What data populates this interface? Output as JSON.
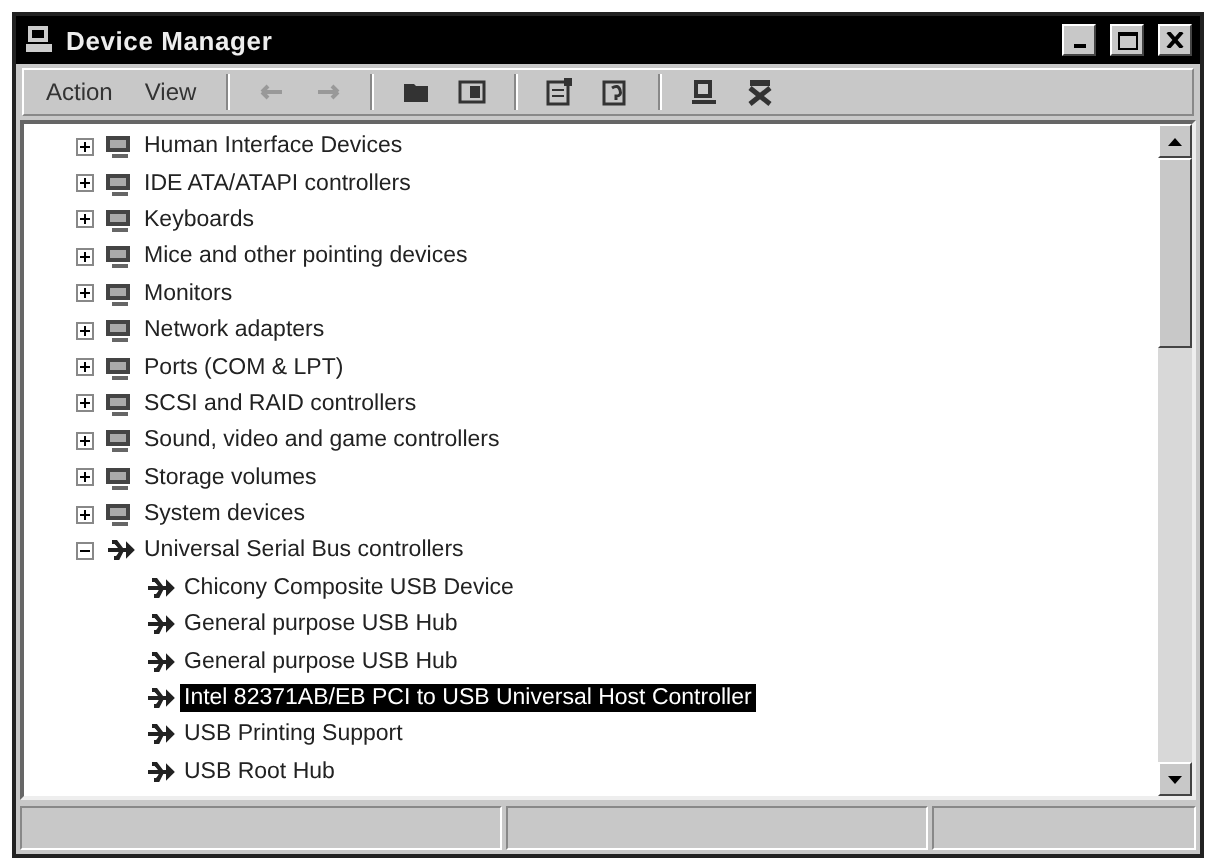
{
  "window": {
    "title": "Device Manager"
  },
  "menu": [
    "Action",
    "View"
  ],
  "toolbar": [
    {
      "kind": "back",
      "disabled": true
    },
    {
      "kind": "forward",
      "disabled": true
    },
    {
      "kind": "folder",
      "disabled": false
    },
    {
      "kind": "panel",
      "disabled": false
    },
    {
      "kind": "properties",
      "disabled": false
    },
    {
      "kind": "help",
      "disabled": false
    },
    {
      "kind": "scan",
      "disabled": false
    },
    {
      "kind": "remove",
      "disabled": false
    }
  ],
  "tree": [
    {
      "label": "Human Interface Devices",
      "expanded": false
    },
    {
      "label": "IDE ATA/ATAPI controllers",
      "expanded": false
    },
    {
      "label": "Keyboards",
      "expanded": false
    },
    {
      "label": "Mice and other pointing devices",
      "expanded": false
    },
    {
      "label": "Monitors",
      "expanded": false
    },
    {
      "label": "Network adapters",
      "expanded": false
    },
    {
      "label": "Ports (COM & LPT)",
      "expanded": false
    },
    {
      "label": "SCSI and RAID controllers",
      "expanded": false
    },
    {
      "label": "Sound, video and game controllers",
      "expanded": false
    },
    {
      "label": "Storage volumes",
      "expanded": false
    },
    {
      "label": "System devices",
      "expanded": false
    },
    {
      "label": "Universal Serial Bus controllers",
      "expanded": true,
      "children": [
        {
          "label": "Chicony Composite USB Device",
          "selected": false
        },
        {
          "label": "General purpose USB Hub",
          "selected": false
        },
        {
          "label": "General purpose USB Hub",
          "selected": false
        },
        {
          "label": "Intel 82371AB/EB PCI to USB Universal Host Controller",
          "selected": true
        },
        {
          "label": "USB Printing Support",
          "selected": false
        },
        {
          "label": "USB Root Hub",
          "selected": false
        }
      ]
    }
  ]
}
